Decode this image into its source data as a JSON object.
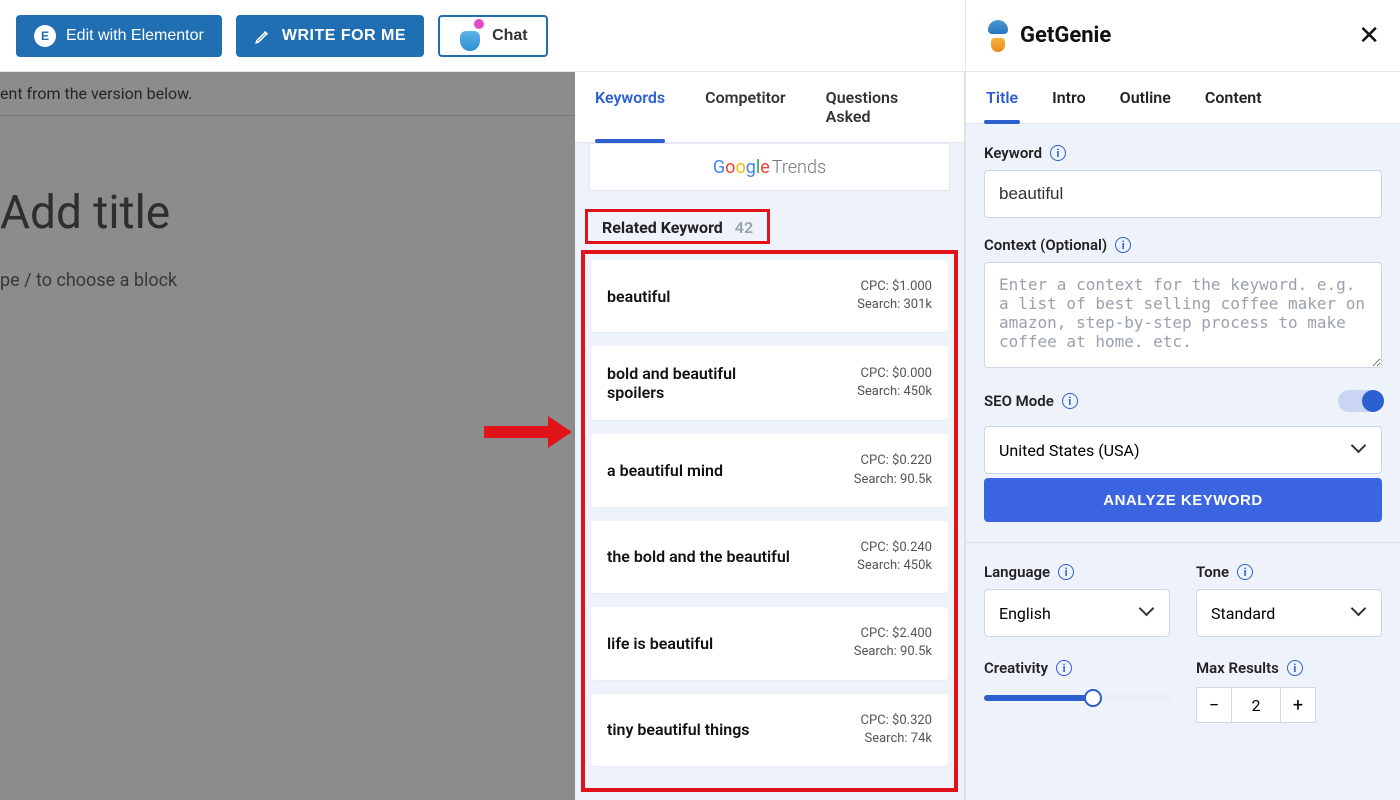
{
  "toolbar": {
    "elementor_label": "Edit with Elementor",
    "write_label": "WRITE FOR ME",
    "chat_label": "Chat"
  },
  "editor": {
    "notice_fragment": "ent from the version below.",
    "title_placeholder": "Add title",
    "block_placeholder": "pe / to choose a block"
  },
  "mid_tabs": [
    "Keywords",
    "Competitor",
    "Questions Asked"
  ],
  "mid_active_tab": 0,
  "google_trends_label": "Trends",
  "related": {
    "heading": "Related Keyword",
    "count": "42"
  },
  "keywords": [
    {
      "term": "beautiful",
      "cpc": "CPC: $1.000",
      "search": "Search: 301k"
    },
    {
      "term": "bold and beautiful spoilers",
      "cpc": "CPC: $0.000",
      "search": "Search: 450k"
    },
    {
      "term": "a beautiful mind",
      "cpc": "CPC: $0.220",
      "search": "Search: 90.5k"
    },
    {
      "term": "the bold and the beautiful",
      "cpc": "CPC: $0.240",
      "search": "Search: 450k"
    },
    {
      "term": "life is beautiful",
      "cpc": "CPC: $2.400",
      "search": "Search: 90.5k"
    },
    {
      "term": "tiny beautiful things",
      "cpc": "CPC: $0.320",
      "search": "Search: 74k"
    }
  ],
  "genie": {
    "brand": "GetGenie",
    "tabs": [
      "Title",
      "Intro",
      "Outline",
      "Content"
    ],
    "active_tab": 0,
    "keyword_label": "Keyword",
    "keyword_value": "beautiful",
    "context_label": "Context (Optional)",
    "context_placeholder": "Enter a context for the keyword. e.g. a list of best selling coffee maker on amazon, step-by-step process to make coffee at home. etc.",
    "seo_mode_label": "SEO Mode",
    "country_value": "United States (USA)",
    "analyze_label": "ANALYZE KEYWORD",
    "language_label": "Language",
    "language_value": "English",
    "tone_label": "Tone",
    "tone_value": "Standard",
    "creativity_label": "Creativity",
    "max_results_label": "Max Results",
    "max_results_value": "2"
  }
}
